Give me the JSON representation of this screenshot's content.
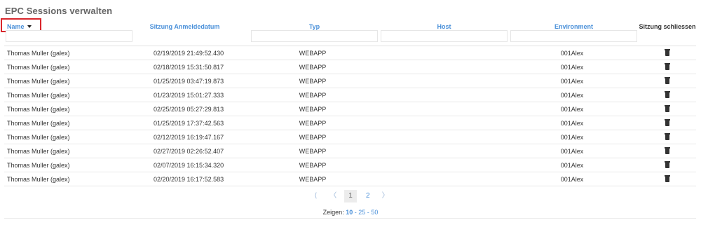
{
  "page_title": "EPC Sessions verwalten",
  "columns": {
    "name": "Name",
    "date": "Sitzung Anmeldedatum",
    "typ": "Typ",
    "host": "Host",
    "environment": "Environment",
    "close": "Sitzung schliessen"
  },
  "rows": [
    {
      "name": "Thomas Muller (galex)",
      "date": "02/19/2019  21:49:52.430",
      "typ": "WEBAPP",
      "host": "",
      "env": "001Alex"
    },
    {
      "name": "Thomas Muller (galex)",
      "date": "02/18/2019  15:31:50.817",
      "typ": "WEBAPP",
      "host": "",
      "env": "001Alex"
    },
    {
      "name": "Thomas Muller (galex)",
      "date": "01/25/2019  03:47:19.873",
      "typ": "WEBAPP",
      "host": "",
      "env": "001Alex"
    },
    {
      "name": "Thomas Muller (galex)",
      "date": "01/23/2019  15:01:27.333",
      "typ": "WEBAPP",
      "host": "",
      "env": "001Alex"
    },
    {
      "name": "Thomas Muller (galex)",
      "date": "02/25/2019  05:27:29.813",
      "typ": "WEBAPP",
      "host": "",
      "env": "001Alex"
    },
    {
      "name": "Thomas Muller (galex)",
      "date": "01/25/2019  17:37:42.563",
      "typ": "WEBAPP",
      "host": "",
      "env": "001Alex"
    },
    {
      "name": "Thomas Muller (galex)",
      "date": "02/12/2019  16:19:47.167",
      "typ": "WEBAPP",
      "host": "",
      "env": "001Alex"
    },
    {
      "name": "Thomas Muller (galex)",
      "date": "02/27/2019  02:26:52.407",
      "typ": "WEBAPP",
      "host": "",
      "env": "001Alex"
    },
    {
      "name": "Thomas Muller (galex)",
      "date": "02/07/2019  16:15:34.320",
      "typ": "WEBAPP",
      "host": "",
      "env": "001Alex"
    },
    {
      "name": "Thomas Muller (galex)",
      "date": "02/20/2019  16:17:52.583",
      "typ": "WEBAPP",
      "host": "",
      "env": "001Alex"
    }
  ],
  "pagination": {
    "first": "⟨",
    "prev": "〈",
    "pages": [
      "1",
      "2"
    ],
    "active_page": "1",
    "next": "〉"
  },
  "page_size": {
    "label": "Zeigen:",
    "options": [
      "10",
      "25",
      "50"
    ],
    "selected": "10"
  },
  "icons": {
    "sort": "sort-desc-caret",
    "delete": "trash-icon"
  },
  "colors": {
    "link": "#4a90d9",
    "highlight": "#d9262c"
  }
}
